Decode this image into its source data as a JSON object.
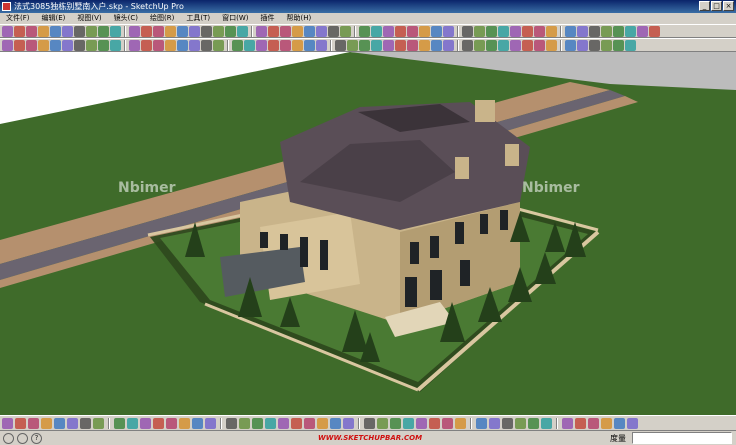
{
  "window": {
    "title": "法式3085独栋别墅南入户.skp - SketchUp Pro"
  },
  "menu": [
    "文件(F)",
    "编辑(E)",
    "视图(V)",
    "镜头(C)",
    "绘图(R)",
    "工具(T)",
    "窗口(W)",
    "插件",
    "帮助(H)"
  ],
  "window_buttons": [
    "_",
    "□",
    "×"
  ],
  "watermarks": [
    "Nbimer",
    "Nbimer"
  ],
  "status": {
    "brand": "WWW.SKETCHUPBAR.COM",
    "measure_label": "度量",
    "measure_value": "",
    "help_icon": "?"
  },
  "colors": {
    "sky": "#ffffff",
    "grass": "#3f6b2a",
    "road": "#6a6470",
    "walkway": "#b5906e",
    "wall": "#c9b48a",
    "roof": "#5a4e57"
  }
}
